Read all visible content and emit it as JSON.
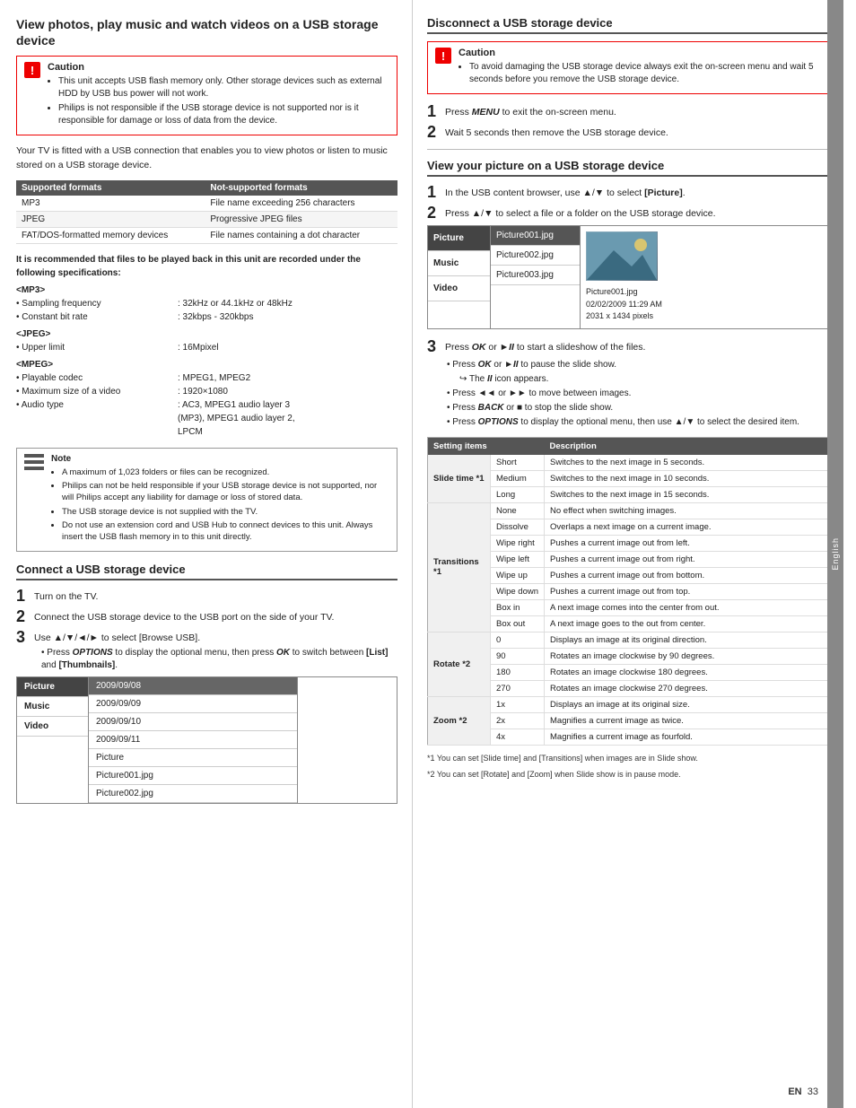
{
  "left": {
    "main_title": "View photos, play music and watch videos on a USB storage device",
    "caution": {
      "label": "Caution",
      "items": [
        "This unit accepts USB flash memory only. Other storage devices such as external HDD by USB bus power will not work.",
        "Philips is not responsible if the USB storage device is not supported nor is it responsible for damage or loss of data from the device."
      ]
    },
    "intro": "Your TV is fitted with a USB connection that enables you to view photos or listen to music stored on a USB storage device.",
    "formats_table": {
      "headers": [
        "Supported formats",
        "Not-supported formats"
      ],
      "rows": [
        [
          "MP3",
          "File name exceeding 256 characters"
        ],
        [
          "JPEG",
          "Progressive JPEG files"
        ],
        [
          "FAT/DOS-formatted memory devices",
          "File names containing a dot character"
        ]
      ]
    },
    "specs_intro": "It is recommended that files to be played back in this unit are recorded under the following specifications:",
    "specs": {
      "mp3_label": "<MP3>",
      "mp3_items": [
        {
          "label": "• Sampling frequency",
          "value": ": 32kHz or 44.1kHz or 48kHz"
        },
        {
          "label": "• Constant bit rate",
          "value": ": 32kbps - 320kbps"
        }
      ],
      "jpeg_label": "<JPEG>",
      "jpeg_items": [
        {
          "label": "• Upper limit",
          "value": ": 16Mpixel"
        }
      ],
      "mpeg_label": "<MPEG>",
      "mpeg_items": [
        {
          "label": "• Playable codec",
          "value": ": MPEG1, MPEG2"
        },
        {
          "label": "• Maximum size of a video",
          "value": ": 1920×1080"
        },
        {
          "label": "• Audio type",
          "value": ": AC3, MPEG1 audio layer 3 (MP3), MPEG1 audio layer 2, LPCM"
        }
      ]
    },
    "note": {
      "label": "Note",
      "items": [
        "A maximum of 1,023 folders or files can be recognized.",
        "Philips can not be held responsible if your USB storage device is not supported, nor will Philips accept any liability for damage or loss of stored data.",
        "The USB storage device is not supplied with the TV.",
        "Do not use an extension cord and USB Hub to connect devices to this unit. Always insert the USB flash memory in to this unit directly."
      ]
    },
    "connect_section": {
      "title": "Connect a USB storage device",
      "steps": [
        {
          "num": "1",
          "text": "Turn on the TV."
        },
        {
          "num": "2",
          "text": "Connect the USB storage device to the USB port on the side of your TV."
        },
        {
          "num": "3",
          "text": "Use ▲/▼/◄/► to select [Browse USB].",
          "sub": [
            "Press OPTIONS to display the optional menu, then press OK to switch between [List] and [Thumbnails]."
          ]
        }
      ]
    },
    "browser_items_left": [
      "Picture",
      "Music",
      "Video"
    ],
    "browser_items_mid": [
      "2009/09/08",
      "2009/09/09",
      "2009/09/10",
      "2009/09/11",
      "Picture",
      "Picture001.jpg",
      "Picture002.jpg"
    ],
    "browser_highlighted_mid": "2009/09/08"
  },
  "right": {
    "disconnect_section": {
      "title": "Disconnect a USB storage device",
      "caution_label": "Caution",
      "caution_text": "To avoid damaging the USB storage device always exit the on-screen menu and wait 5 seconds before you remove the USB storage device.",
      "steps": [
        {
          "num": "1",
          "text": "Press MENU to exit the on-screen menu."
        },
        {
          "num": "2",
          "text": "Wait 5 seconds then remove the USB storage device."
        }
      ]
    },
    "view_section": {
      "title": "View your picture on a USB storage device",
      "steps": [
        {
          "num": "1",
          "text": "In the USB content browser, use ▲/▼ to select [Picture]."
        },
        {
          "num": "2",
          "text": "Press ▲/▼ to select a file or a folder on the USB storage device."
        }
      ],
      "browser": {
        "left_items": [
          "Picture",
          "Music",
          "Video"
        ],
        "mid_items": [
          "Picture001.jpg",
          "Picture002.jpg",
          "Picture003.jpg"
        ],
        "highlighted_mid": "Picture001.jpg",
        "thumb_alt": "mountain landscape",
        "info_lines": [
          "Picture001.jpg",
          "02/02/2009 11:29 AM",
          "2031 x 1434 pixels"
        ]
      },
      "step3_text": "Press OK or ►II to start a slideshow of the files.",
      "step3_subs": [
        "Press OK or ►II to pause the slide show.",
        "The II icon appears.",
        "Press ◄◄ or ►► to move between images.",
        "Press BACK or ■ to stop the slide show.",
        "Press OPTIONS to display the optional menu, then use ▲/▼ to select the desired item."
      ],
      "step3_arrow": "The II icon appears."
    },
    "settings_table": {
      "headers": [
        "Setting items",
        "",
        "Description"
      ],
      "groups": [
        {
          "group_label": "Slide time *1",
          "rows": [
            {
              "sub": "Short",
              "desc": "Switches to the next image in 5 seconds."
            },
            {
              "sub": "Medium",
              "desc": "Switches to the next image in 10 seconds."
            },
            {
              "sub": "Long",
              "desc": "Switches to the next image in 15 seconds."
            }
          ]
        },
        {
          "group_label": "Transitions *1",
          "rows": [
            {
              "sub": "None",
              "desc": "No effect when switching images."
            },
            {
              "sub": "Dissolve",
              "desc": "Overlaps a next image on a current image."
            },
            {
              "sub": "Wipe right",
              "desc": "Pushes a current image out from left."
            },
            {
              "sub": "Wipe left",
              "desc": "Pushes a current image out from right."
            },
            {
              "sub": "Wipe up",
              "desc": "Pushes a current image out from bottom."
            },
            {
              "sub": "Wipe down",
              "desc": "Pushes a current image out from top."
            },
            {
              "sub": "Box in",
              "desc": "A next image comes into the center from out."
            },
            {
              "sub": "Box out",
              "desc": "A next image goes to the out from center."
            }
          ]
        },
        {
          "group_label": "Rotate *2",
          "rows": [
            {
              "sub": "0",
              "desc": "Displays an image at its original direction."
            },
            {
              "sub": "90",
              "desc": "Rotates an image clockwise by 90 degrees."
            },
            {
              "sub": "180",
              "desc": "Rotates an image clockwise 180 degrees."
            },
            {
              "sub": "270",
              "desc": "Rotates an image clockwise 270 degrees."
            }
          ]
        },
        {
          "group_label": "Zoom *2",
          "rows": [
            {
              "sub": "1x",
              "desc": "Displays an image at its original size."
            },
            {
              "sub": "2x",
              "desc": "Magnifies a current image as twice."
            },
            {
              "sub": "4x",
              "desc": "Magnifies a current image as fourfold."
            }
          ]
        }
      ],
      "footnotes": [
        "*1 You can set [Slide time] and [Transitions] when images are in Slide show.",
        "*2 You can set [Rotate] and [Zoom] when Slide show is in pause mode."
      ]
    },
    "page_num": "33",
    "en_label": "EN",
    "side_tab": "English"
  }
}
